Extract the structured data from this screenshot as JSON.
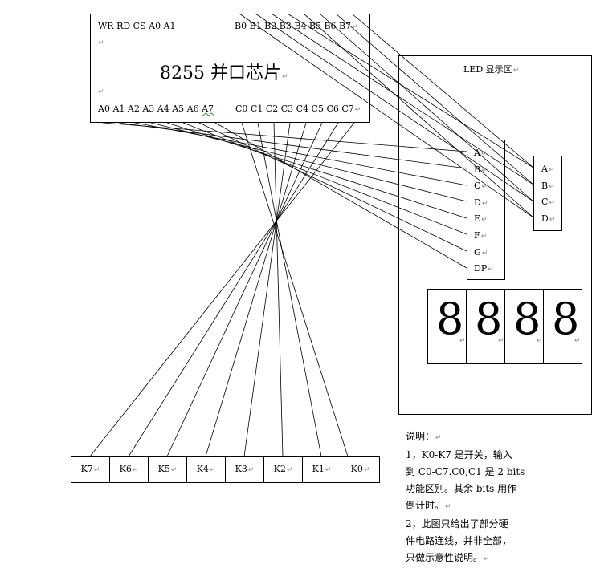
{
  "chip": {
    "top_left_pins": "WR RD CS A0 A1",
    "top_right_pins": "B0 B1 B2 B3 B4 B5 B6 B7",
    "title": "8255  并口芯片",
    "bottom_a_pins_main": "A0 A1 A2 A3 A4 A5 A6",
    "bottom_a_pin_last": "A7",
    "bottom_c_pins": "C0 C1 C2 C3 C4 C5 C6 C7"
  },
  "led_area": {
    "title": "LED 显示区",
    "segment_labels": [
      "A",
      "B",
      "C",
      "D",
      "E",
      "F",
      "G",
      "DP"
    ],
    "select_labels": [
      "A",
      "B",
      "C",
      "D"
    ],
    "digits": [
      "8",
      "8",
      "8",
      "8"
    ]
  },
  "keys": [
    "K7",
    "K6",
    "K5",
    "K4",
    "K3",
    "K2",
    "K1",
    "K0"
  ],
  "notes": {
    "heading": "说明：",
    "line1": "1，K0-K7 是开关，输入",
    "line2": "到 C0-C7.C0,C1 是 2 bits",
    "line3": "功能区别。其余 bits 用作",
    "line4": "倒计时。",
    "line5": "2，此图只给出了部分硬",
    "line6": "件电路连线，并非全部，",
    "line7": "只做示意性说明。"
  },
  "return_mark": "↵"
}
